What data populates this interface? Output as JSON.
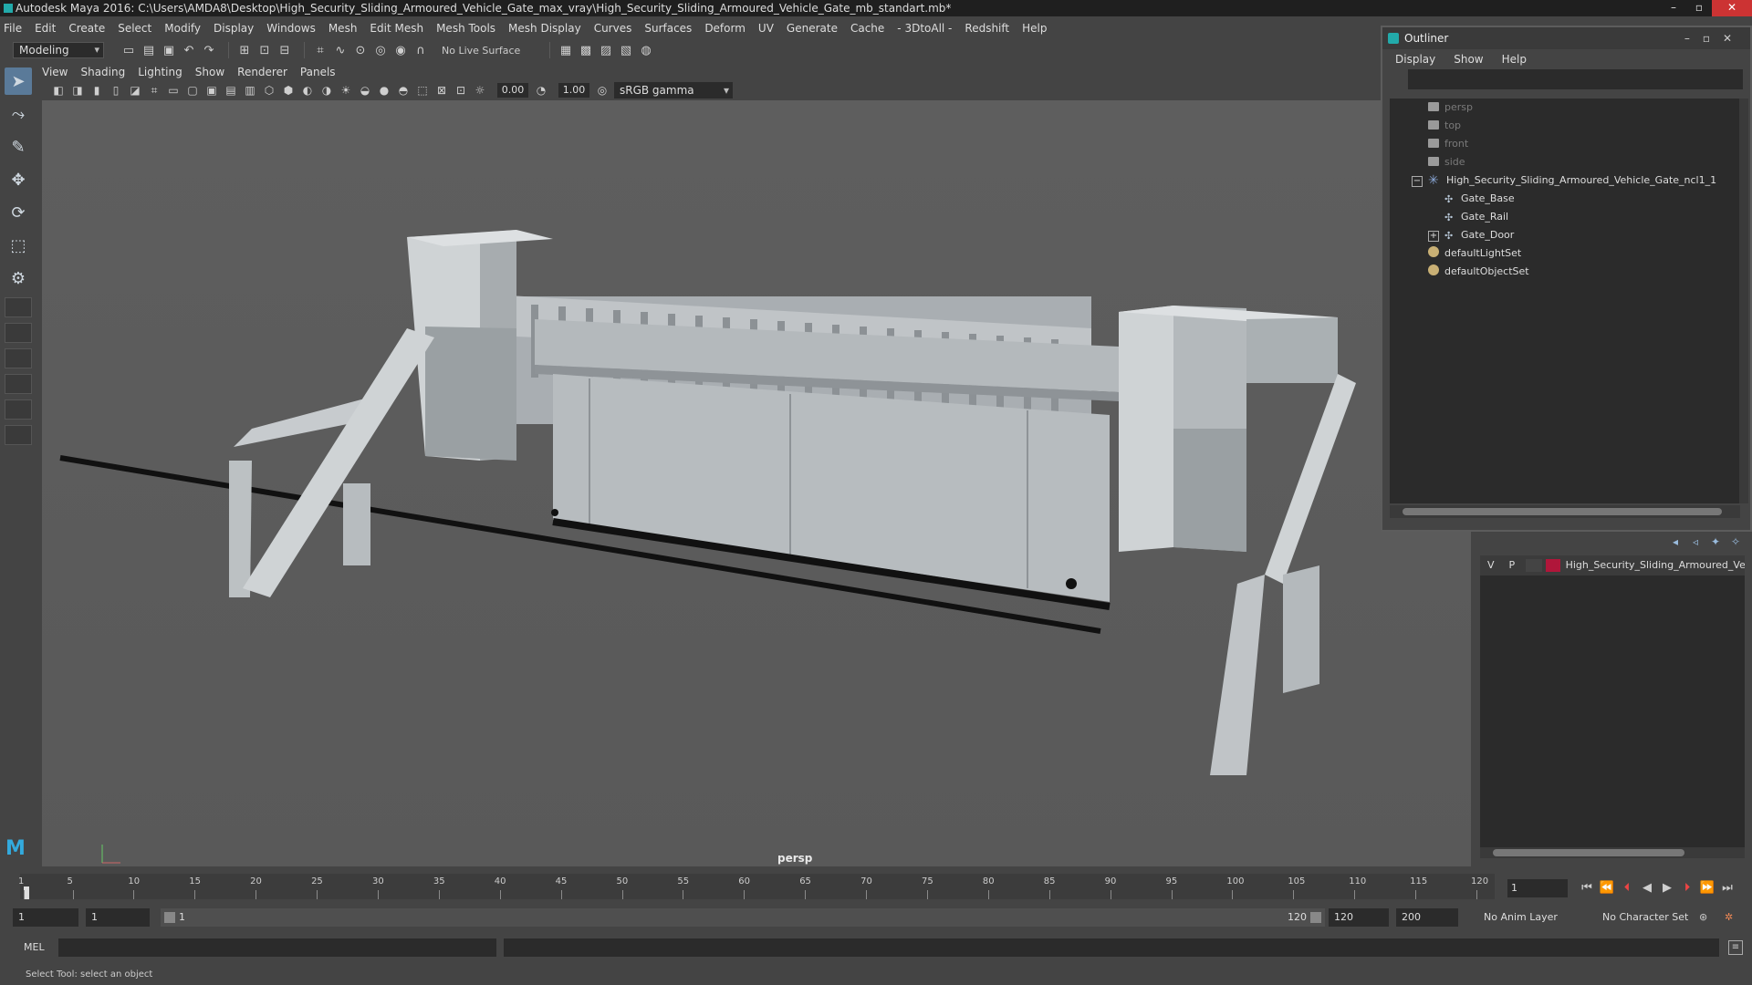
{
  "window": {
    "title": "Autodesk Maya 2016: C:\\Users\\AMDA8\\Desktop\\High_Security_Sliding_Armoured_Vehicle_Gate_max_vray\\High_Security_Sliding_Armoured_Vehicle_Gate_mb_standart.mb*"
  },
  "menubar": [
    "File",
    "Edit",
    "Create",
    "Select",
    "Modify",
    "Display",
    "Windows",
    "Mesh",
    "Edit Mesh",
    "Mesh Tools",
    "Mesh Display",
    "Curves",
    "Surfaces",
    "Deform",
    "UV",
    "Generate",
    "Cache",
    "- 3DtoAll -",
    "Redshift",
    "Help"
  ],
  "toolbar": {
    "mode": "Modeling",
    "live_surface": "No Live Surface"
  },
  "panel": {
    "menu": [
      "View",
      "Shading",
      "Lighting",
      "Show",
      "Renderer",
      "Panels"
    ],
    "exposure": "0.00",
    "gamma": "1.00",
    "color_space": "sRGB gamma",
    "camera_label": "persp"
  },
  "outliner": {
    "title": "Outliner",
    "menu": [
      "Display",
      "Show",
      "Help"
    ],
    "items": [
      {
        "label": "persp",
        "type": "camera",
        "dim": true
      },
      {
        "label": "top",
        "type": "camera",
        "dim": true
      },
      {
        "label": "front",
        "type": "camera",
        "dim": true
      },
      {
        "label": "side",
        "type": "camera",
        "dim": true
      },
      {
        "label": "High_Security_Sliding_Armoured_Vehicle_Gate_ncl1_1",
        "type": "group",
        "expander": "−"
      },
      {
        "label": "Gate_Base",
        "type": "mesh",
        "indent": 2
      },
      {
        "label": "Gate_Rail",
        "type": "mesh",
        "indent": 2
      },
      {
        "label": "Gate_Door",
        "type": "mesh",
        "indent": 2,
        "expander": "+"
      },
      {
        "label": "defaultLightSet",
        "type": "set"
      },
      {
        "label": "defaultObjectSet",
        "type": "set"
      }
    ]
  },
  "layers": {
    "row": {
      "v": "V",
      "p": "P",
      "name": "High_Security_Sliding_Armoured_Vehicle_Gate",
      "color": "#b0163a"
    }
  },
  "timeline": {
    "ticks": [
      "1",
      "5",
      "10",
      "15",
      "20",
      "25",
      "30",
      "35",
      "40",
      "45",
      "50",
      "55",
      "60",
      "65",
      "70",
      "75",
      "80",
      "85",
      "90",
      "95",
      "100",
      "105",
      "110",
      "115",
      "120"
    ],
    "current_frame": "1"
  },
  "range": {
    "start": "1",
    "current": "1",
    "slider_start": "1",
    "slider_end": "120",
    "end": "120",
    "max": "200",
    "anim_layer": "No Anim Layer",
    "character_set": "No Character Set"
  },
  "cmdline": {
    "label": "MEL"
  },
  "helpline": {
    "text": "Select Tool: select an object"
  }
}
